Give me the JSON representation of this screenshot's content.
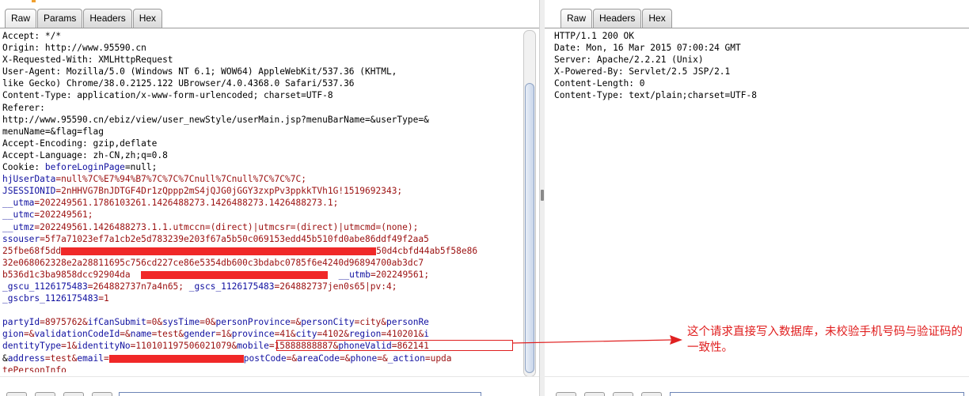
{
  "request_pane": {
    "tabs": [
      "Raw",
      "Params",
      "Headers",
      "Hex"
    ],
    "active_tab": "Raw",
    "lines": [
      [
        {
          "t": "Accept: */*"
        }
      ],
      [
        {
          "t": "Origin: http://www.95590.cn"
        }
      ],
      [
        {
          "t": "X-Requested-With: XMLHttpRequest"
        }
      ],
      [
        {
          "t": "User-Agent: Mozilla/5.0 (Windows NT 6.1; WOW64) AppleWebKit/537.36 (KHTML,"
        }
      ],
      [
        {
          "t": "like Gecko) Chrome/38.0.2125.122 UBrowser/4.0.4368.0 Safari/537.36"
        }
      ],
      [
        {
          "t": "Content-Type: application/x-www-form-urlencoded; charset=UTF-8"
        }
      ],
      [
        {
          "t": "Referer:"
        }
      ],
      [
        {
          "t": "http://www.95590.cn/ebiz/view/user_newStyle/userMain.jsp?menuBarName=&userType=&"
        }
      ],
      [
        {
          "t": "menuName=&flag=flag"
        }
      ],
      [
        {
          "t": "Accept-Encoding: gzip,deflate"
        }
      ],
      [
        {
          "t": "Accept-Language: zh-CN,zh;q=0.8"
        }
      ],
      [
        {
          "t": "Cookie: "
        },
        {
          "t": "beforeLoginPage",
          "c": "k"
        },
        {
          "t": "=null;"
        }
      ],
      [
        {
          "t": "hjUserData",
          "c": "k"
        },
        {
          "t": "=null%7C%E7%94%B7%7C%7C%7Cnull%7Cnull%7C%7C%7C;",
          "c": "v"
        }
      ],
      [
        {
          "t": "JSESSIONID",
          "c": "k"
        },
        {
          "t": "=2nHHVG7BnJDTGF4Dr1zQppp2mS4jQJG0jGGY3zxpPv3ppkkTVh1G!1519692343;",
          "c": "v"
        }
      ],
      [
        {
          "t": "__utma",
          "c": "k"
        },
        {
          "t": "=202249561.1786103261.1426488273.1426488273.1426488273.1;",
          "c": "v"
        }
      ],
      [
        {
          "t": "__utmc",
          "c": "k"
        },
        {
          "t": "=202249561;",
          "c": "v"
        }
      ],
      [
        {
          "t": "__utmz",
          "c": "k"
        },
        {
          "t": "=202249561.1426488273.1.1.utmccn=(direct)|utmcsr=(direct)|utmcmd=(none);",
          "c": "v"
        }
      ],
      [
        {
          "t": "ssouser",
          "c": "k"
        },
        {
          "t": "=5f7a71023ef7a1cb2e5d783239e203f67a5b50c069153edd45b510fd0abe86ddf49f2aa5",
          "c": "v"
        }
      ],
      [
        {
          "t": "25fbe68f5dd",
          "c": "v"
        },
        {
          "redact": true,
          "w": 398
        },
        {
          "t": "50d4cbfd44ab5f58e86",
          "c": "v"
        }
      ],
      [
        {
          "t": "32e068062328e2a28811695c756cd227ce86e5354db600c3bdabc0785f6e4240d96894700ab3dc7",
          "c": "v"
        }
      ],
      [
        {
          "t": "b536d1c3ba9858dcc92904da  ",
          "c": "v"
        },
        {
          "redact": true,
          "w": 236
        },
        {
          "t": "  "
        },
        {
          "t": "__utmb",
          "c": "k"
        },
        {
          "t": "=202249561;",
          "c": "v"
        }
      ],
      [
        {
          "t": "_gscu_1126175483",
          "c": "k"
        },
        {
          "t": "=264882737n7a4n65; ",
          "c": "v"
        },
        {
          "t": "_gscs_1126175483",
          "c": "k"
        },
        {
          "t": "=264882737jen0s65|pv:4;",
          "c": "v"
        }
      ],
      [
        {
          "t": "_gscbrs_1126175483",
          "c": "k"
        },
        {
          "t": "=1",
          "c": "v"
        }
      ],
      [
        {
          "t": ""
        }
      ],
      [
        {
          "t": "partyId",
          "c": "k"
        },
        {
          "t": "=8975762&",
          "c": "v"
        },
        {
          "t": "ifCanSubmit",
          "c": "k"
        },
        {
          "t": "=0&",
          "c": "v"
        },
        {
          "t": "sysTime",
          "c": "k"
        },
        {
          "t": "=0&",
          "c": "v"
        },
        {
          "t": "personProvince",
          "c": "k"
        },
        {
          "t": "=&",
          "c": "v"
        },
        {
          "t": "personCity",
          "c": "k"
        },
        {
          "t": "=city&",
          "c": "v"
        },
        {
          "t": "personRe",
          "c": "k"
        }
      ],
      [
        {
          "t": "gion",
          "c": "k"
        },
        {
          "t": "=&",
          "c": "v"
        },
        {
          "t": "validationCodeId",
          "c": "k"
        },
        {
          "t": "=&",
          "c": "v"
        },
        {
          "t": "name",
          "c": "k"
        },
        {
          "t": "=test&",
          "c": "v"
        },
        {
          "t": "gender",
          "c": "k"
        },
        {
          "t": "=1&",
          "c": "v"
        },
        {
          "t": "province",
          "c": "k"
        },
        {
          "t": "=41&",
          "c": "v"
        },
        {
          "t": "city",
          "c": "k"
        },
        {
          "t": "=4102&",
          "c": "v"
        },
        {
          "t": "region",
          "c": "k"
        },
        {
          "t": "=410201&",
          "c": "v"
        },
        {
          "t": "i",
          "c": "k"
        }
      ],
      [
        {
          "t": "dentityType",
          "c": "k"
        },
        {
          "t": "=1&",
          "c": "v"
        },
        {
          "t": "identityNo",
          "c": "k"
        },
        {
          "t": "=110101197506021079&",
          "c": "v"
        },
        {
          "t": "mobile",
          "c": "k"
        },
        {
          "t": "=15888888887&",
          "c": "v"
        },
        {
          "t": "phoneValid",
          "c": "k"
        },
        {
          "t": "=862141",
          "c": "v"
        }
      ],
      [
        {
          "t": "&"
        },
        {
          "t": "address",
          "c": "k"
        },
        {
          "t": "=test&",
          "c": "v"
        },
        {
          "t": "email",
          "c": "k"
        },
        {
          "t": "=",
          "c": "v"
        },
        {
          "redact": true,
          "w": 170
        },
        {
          "t": "postCode",
          "c": "k"
        },
        {
          "t": "=&",
          "c": "v"
        },
        {
          "t": "areaCode",
          "c": "k"
        },
        {
          "t": "=&",
          "c": "v"
        },
        {
          "t": "phone",
          "c": "k"
        },
        {
          "t": "=&",
          "c": "v"
        },
        {
          "t": "_action",
          "c": "k"
        },
        {
          "t": "=upda",
          "c": "v"
        }
      ],
      [
        {
          "t": "tePersonInfo",
          "c": "v"
        }
      ]
    ]
  },
  "response_pane": {
    "tabs": [
      "Raw",
      "Headers",
      "Hex"
    ],
    "active_tab": "Raw",
    "lines": [
      "HTTP/1.1 200 OK",
      "Date: Mon, 16 Mar 2015 07:00:24 GMT",
      "Server: Apache/2.2.21 (Unix)",
      "X-Powered-By: Servlet/2.5 JSP/2.1",
      "Content-Length: 0",
      "Content-Type: text/plain;charset=UTF-8"
    ]
  },
  "annotation": {
    "text": "这个请求直接写入数据库，未校验手机号码与验证码的一致性。",
    "color": "#e02020"
  },
  "colors": {
    "param_name": "#1010a0",
    "param_value": "#9b1010",
    "redaction": "#f02828"
  }
}
